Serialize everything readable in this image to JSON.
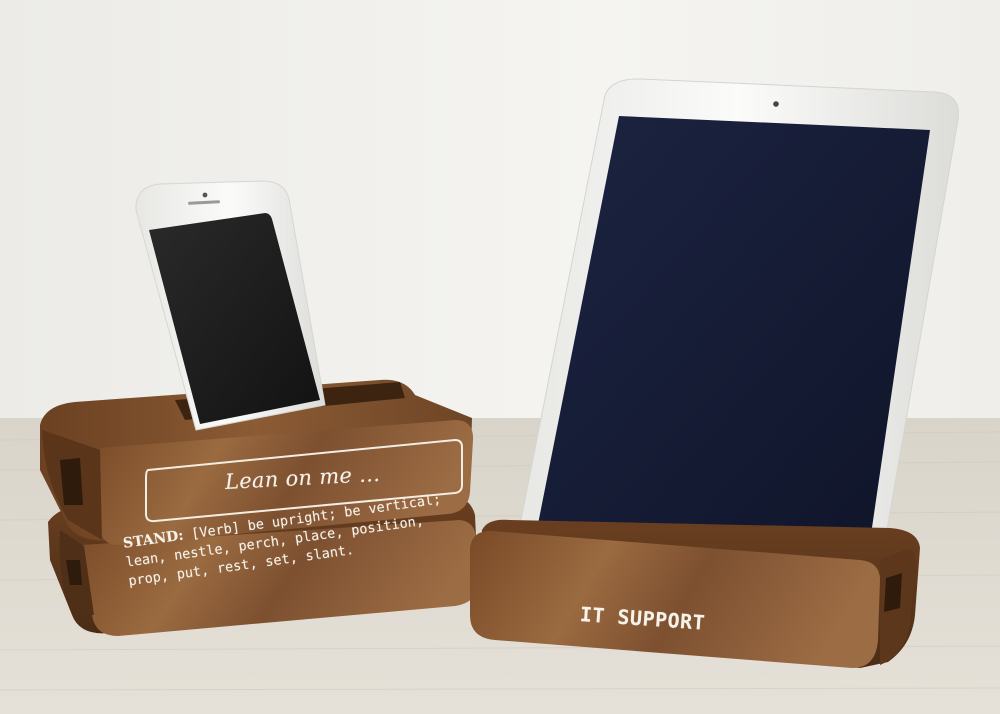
{
  "scene": {
    "colors": {
      "wall": "#f2f0ec",
      "table": "#e2ddd3",
      "walnut_dark": "#5b3a20",
      "walnut_mid": "#8a5a34",
      "walnut_light": "#a8784c",
      "device_white": "#f6f6f4",
      "screen_phone": "#1d1d1d",
      "screen_tablet": "#141b33",
      "engraving": "#f7f3ea"
    }
  },
  "top_stand": {
    "engraving": "Lean on me ..."
  },
  "bottom_stand": {
    "definition_head": "STAND:",
    "definition_lines": [
      "[Verb] be upright; be vertical;",
      "lean, nestle, perch, place, position,",
      "prop, put, rest, set, slant."
    ]
  },
  "tablet_stand": {
    "engraving": "IT SUPPORT"
  }
}
